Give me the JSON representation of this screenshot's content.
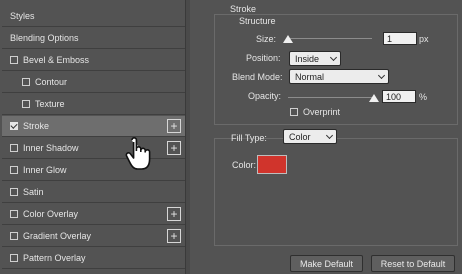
{
  "sidebar": {
    "items": [
      {
        "label": "Styles",
        "checkbox": false,
        "checked": false,
        "plus": false,
        "indent": false,
        "selected": false
      },
      {
        "label": "Blending Options",
        "checkbox": false,
        "checked": false,
        "plus": false,
        "indent": false,
        "selected": false
      },
      {
        "label": "Bevel & Emboss",
        "checkbox": true,
        "checked": false,
        "plus": false,
        "indent": false,
        "selected": false
      },
      {
        "label": "Contour",
        "checkbox": true,
        "checked": false,
        "plus": false,
        "indent": true,
        "selected": false
      },
      {
        "label": "Texture",
        "checkbox": true,
        "checked": false,
        "plus": false,
        "indent": true,
        "selected": false
      },
      {
        "label": "Stroke",
        "checkbox": true,
        "checked": true,
        "plus": true,
        "indent": false,
        "selected": true
      },
      {
        "label": "Inner Shadow",
        "checkbox": true,
        "checked": false,
        "plus": true,
        "indent": false,
        "selected": false
      },
      {
        "label": "Inner Glow",
        "checkbox": true,
        "checked": false,
        "plus": false,
        "indent": false,
        "selected": false
      },
      {
        "label": "Satin",
        "checkbox": true,
        "checked": false,
        "plus": false,
        "indent": false,
        "selected": false
      },
      {
        "label": "Color Overlay",
        "checkbox": true,
        "checked": false,
        "plus": true,
        "indent": false,
        "selected": false
      },
      {
        "label": "Gradient Overlay",
        "checkbox": true,
        "checked": false,
        "plus": true,
        "indent": false,
        "selected": false
      },
      {
        "label": "Pattern Overlay",
        "checkbox": true,
        "checked": false,
        "plus": false,
        "indent": false,
        "selected": false
      }
    ],
    "plus_symbol": "+"
  },
  "stroke": {
    "section_title": "Stroke",
    "structure_title": "Structure",
    "size_label": "Size:",
    "size_value": "1",
    "size_unit": "px",
    "size_level": 0.0,
    "position_label": "Position:",
    "position_value": "Inside",
    "blend_mode_label": "Blend Mode:",
    "blend_mode_value": "Normal",
    "opacity_label": "Opacity:",
    "opacity_value": "100",
    "opacity_unit": "%",
    "opacity_level": 1.0,
    "overprint_label": "Overprint",
    "overprint_checked": false,
    "fill_type_label": "Fill Type:",
    "fill_type_value": "Color",
    "color_label": "Color:",
    "color_value": "#d0342c"
  },
  "buttons": {
    "make_default": "Make Default",
    "reset_to_default": "Reset to Default"
  }
}
